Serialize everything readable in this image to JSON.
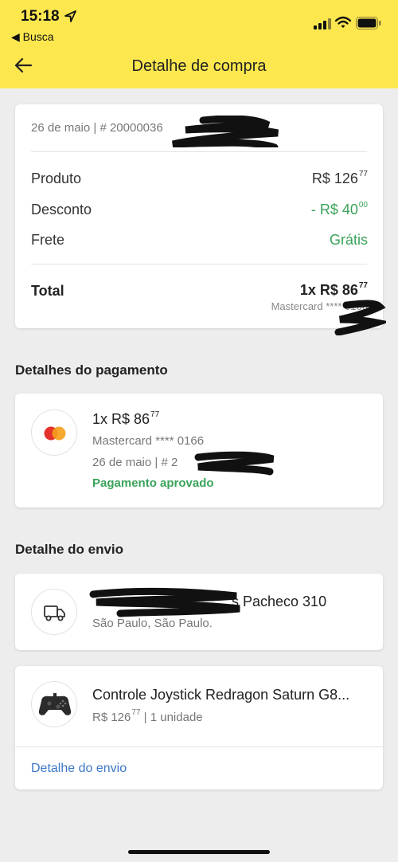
{
  "status_bar": {
    "time": "15:18",
    "back_app": "◀ Busca"
  },
  "nav": {
    "title": "Detalhe de compra"
  },
  "summary": {
    "date_line": "26 de maio  |  # 20000036",
    "rows": [
      {
        "label": "Produto",
        "value": "R$ 126",
        "cents": "77"
      },
      {
        "label": "Desconto",
        "value": "- R$ 40",
        "cents": "00"
      },
      {
        "label": "Frete",
        "value": "Grátis"
      }
    ],
    "total_label": "Total",
    "total_value": "1x R$ 86",
    "total_cents": "77",
    "total_sub": "Mastercard **** 0166"
  },
  "payment": {
    "section_title": "Detalhes do pagamento",
    "amount": "1x R$ 86",
    "amount_cents": "77",
    "card": "Mastercard **** 0166",
    "date_line": "26 de maio  |  # 2",
    "status": "Pagamento aprovado"
  },
  "shipping": {
    "section_title": "Detalhe do envio",
    "address": "s Pacheco 310",
    "city": "São Paulo, São Paulo."
  },
  "product": {
    "name": "Controle Joystick Redragon Saturn G8...",
    "price": "R$ 126",
    "price_cents": "77",
    "quantity": " | 1 unidade",
    "link": "Detalhe do envio"
  },
  "colors": {
    "header_bg": "#fde74f",
    "green": "#3aa35a",
    "link": "#3b78c8"
  }
}
